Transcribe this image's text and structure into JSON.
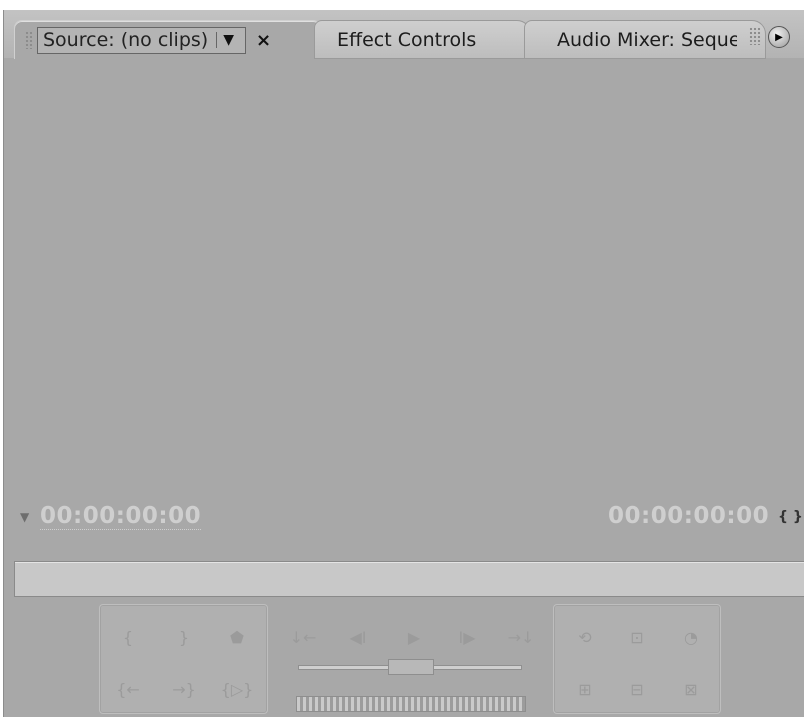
{
  "tabs": {
    "source_label": "Source: (no clips)",
    "dropdown": "▼",
    "close": "×",
    "effect_controls": "Effect Controls",
    "audio_mixer": "Audio Mixer: Sequer"
  },
  "panel_menu_glyph": "▶",
  "timecode": {
    "current": "00:00:00:00",
    "duration": "00:00:00:00"
  },
  "icons": {
    "playhead": "▼",
    "fit": "{ }"
  },
  "controls": {
    "mark_in": "{",
    "mark_out": "}",
    "set_marker": "⬟",
    "goto_in": "{←",
    "goto_out": "→}",
    "play_in_out": "{▷}",
    "step_back_marker": "↓←",
    "step_back": "◀I",
    "play": "▶",
    "step_forward": "I▶",
    "step_forward_marker": "→↓",
    "loop": "⟲",
    "safe_margins": "⊡",
    "output": "◔",
    "insert": "⊞",
    "overlay": "⊟",
    "export_frame": "⊠"
  },
  "colors": {
    "panel_bg": "#a8a8a8",
    "timecode": "#cfcfcf"
  }
}
